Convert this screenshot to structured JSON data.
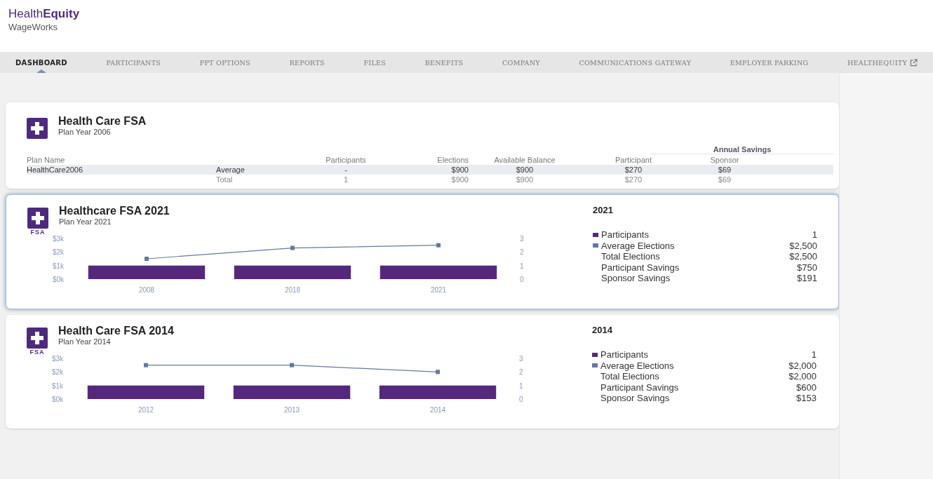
{
  "brand": {
    "name_regular": "Health",
    "name_bold": "Equity",
    "sub": "WageWorks"
  },
  "nav": [
    {
      "label": "DASHBOARD",
      "selected": true
    },
    {
      "label": "PARTICIPANTS",
      "selected": false
    },
    {
      "label": "PPT OPTIONS",
      "selected": false
    },
    {
      "label": "REPORTS",
      "selected": false
    },
    {
      "label": "FILES",
      "selected": false
    },
    {
      "label": "BENEFITS",
      "selected": false
    },
    {
      "label": "COMPANY",
      "selected": false
    },
    {
      "label": "COMMUNICATIONS GATEWAY",
      "selected": false
    },
    {
      "label": "EMPLOYER PARKING",
      "selected": false
    },
    {
      "label": "HEALTHEQUITY",
      "selected": false,
      "external": true
    }
  ],
  "summary": {
    "title": "Health Care FSA",
    "subtitle": "Plan Year 2006",
    "group_header": "Annual Savings",
    "columns": [
      "Plan Name",
      "",
      "Participants",
      "Elections",
      "Available Balance",
      "Participant",
      "Sponsor"
    ],
    "rows": [
      {
        "cells": [
          "HealthCare2006",
          "Average",
          "-",
          "$900",
          "$900",
          "$270",
          "$69"
        ],
        "selected": true
      },
      {
        "cells": [
          "",
          "Total",
          "1",
          "$900",
          "$900",
          "$270",
          "$69"
        ],
        "selected": false
      }
    ]
  },
  "plans": [
    {
      "title": "Healthcare FSA 2021",
      "subtitle": "Plan Year 2021",
      "icon_label": "FSA",
      "focused": true,
      "year": "2021",
      "stats": [
        {
          "kind": "legend",
          "value": "1"
        },
        {
          "kind": "legend",
          "value": "$2,500"
        },
        {
          "label": "Total Elections",
          "value": "$2,500"
        },
        {
          "label": "Participant Savings",
          "value": "$750"
        },
        {
          "label": "Sponsor Savings",
          "value": "$191"
        }
      ],
      "chart_data": {
        "type": "bar",
        "categories": [
          "2008",
          "2018",
          "2021"
        ],
        "series": [
          {
            "name": "Participants",
            "axis": "y2",
            "color": "#55287d",
            "values": [
              1,
              1,
              1
            ]
          },
          {
            "name": "Average Elections",
            "type": "line",
            "marker": true,
            "axis": "y",
            "color": "#6479a0",
            "values": [
              1500,
              2300,
              2500
            ]
          }
        ],
        "ylim": [
          0,
          3000
        ],
        "y2lim": [
          0,
          3
        ],
        "yticks": [
          {
            "value": 0,
            "label": "$0k"
          },
          {
            "value": 1000,
            "label": "$1k"
          },
          {
            "value": 2000,
            "label": "$2k"
          },
          {
            "value": 3000,
            "label": "$3k"
          }
        ],
        "y2ticks": [
          {
            "value": 0,
            "label": "0"
          },
          {
            "value": 1,
            "label": "1"
          },
          {
            "value": 2,
            "label": "2"
          },
          {
            "value": 3,
            "label": "3"
          }
        ]
      }
    },
    {
      "title": "Health Care FSA 2014",
      "subtitle": "Plan Year 2014",
      "icon_label": "FSA",
      "focused": false,
      "year": "2014",
      "stats": [
        {
          "kind": "legend",
          "value": "1"
        },
        {
          "kind": "legend",
          "value": "$2,000"
        },
        {
          "label": "Total Elections",
          "value": "$2,000"
        },
        {
          "label": "Participant Savings",
          "value": "$600"
        },
        {
          "label": "Sponsor Savings",
          "value": "$153"
        }
      ],
      "chart_data": {
        "type": "bar",
        "categories": [
          "2012",
          "2013",
          "2014"
        ],
        "series": [
          {
            "name": "Participants",
            "axis": "y2",
            "color": "#55287d",
            "values": [
              1,
              1,
              1
            ]
          },
          {
            "name": "Average Elections",
            "type": "line",
            "marker": true,
            "axis": "y",
            "color": "#6479a0",
            "values": [
              2500,
              2500,
              2000
            ]
          }
        ],
        "ylim": [
          0,
          3000
        ],
        "y2lim": [
          0,
          3
        ],
        "yticks": [
          {
            "value": 0,
            "label": "$0k"
          },
          {
            "value": 1000,
            "label": "$1k"
          },
          {
            "value": 2000,
            "label": "$2k"
          },
          {
            "value": 3000,
            "label": "$3k"
          }
        ],
        "y2ticks": [
          {
            "value": 0,
            "label": "0"
          },
          {
            "value": 1,
            "label": "1"
          },
          {
            "value": 2,
            "label": "2"
          },
          {
            "value": 3,
            "label": "3"
          }
        ]
      }
    }
  ]
}
